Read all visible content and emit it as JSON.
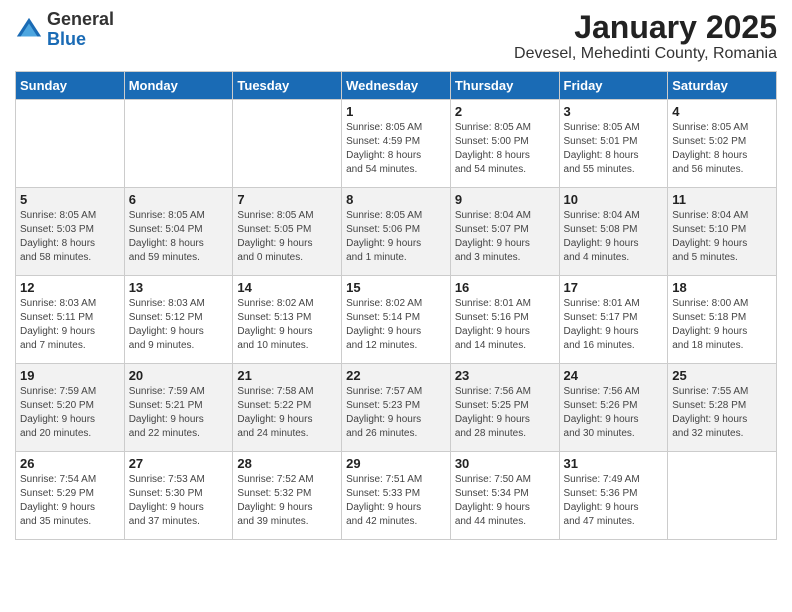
{
  "logo": {
    "general": "General",
    "blue": "Blue"
  },
  "header": {
    "title": "January 2025",
    "subtitle": "Devesel, Mehedinti County, Romania"
  },
  "weekdays": [
    "Sunday",
    "Monday",
    "Tuesday",
    "Wednesday",
    "Thursday",
    "Friday",
    "Saturday"
  ],
  "weeks": [
    [
      {
        "day": "",
        "info": ""
      },
      {
        "day": "",
        "info": ""
      },
      {
        "day": "",
        "info": ""
      },
      {
        "day": "1",
        "info": "Sunrise: 8:05 AM\nSunset: 4:59 PM\nDaylight: 8 hours\nand 54 minutes."
      },
      {
        "day": "2",
        "info": "Sunrise: 8:05 AM\nSunset: 5:00 PM\nDaylight: 8 hours\nand 54 minutes."
      },
      {
        "day": "3",
        "info": "Sunrise: 8:05 AM\nSunset: 5:01 PM\nDaylight: 8 hours\nand 55 minutes."
      },
      {
        "day": "4",
        "info": "Sunrise: 8:05 AM\nSunset: 5:02 PM\nDaylight: 8 hours\nand 56 minutes."
      }
    ],
    [
      {
        "day": "5",
        "info": "Sunrise: 8:05 AM\nSunset: 5:03 PM\nDaylight: 8 hours\nand 58 minutes."
      },
      {
        "day": "6",
        "info": "Sunrise: 8:05 AM\nSunset: 5:04 PM\nDaylight: 8 hours\nand 59 minutes."
      },
      {
        "day": "7",
        "info": "Sunrise: 8:05 AM\nSunset: 5:05 PM\nDaylight: 9 hours\nand 0 minutes."
      },
      {
        "day": "8",
        "info": "Sunrise: 8:05 AM\nSunset: 5:06 PM\nDaylight: 9 hours\nand 1 minute."
      },
      {
        "day": "9",
        "info": "Sunrise: 8:04 AM\nSunset: 5:07 PM\nDaylight: 9 hours\nand 3 minutes."
      },
      {
        "day": "10",
        "info": "Sunrise: 8:04 AM\nSunset: 5:08 PM\nDaylight: 9 hours\nand 4 minutes."
      },
      {
        "day": "11",
        "info": "Sunrise: 8:04 AM\nSunset: 5:10 PM\nDaylight: 9 hours\nand 5 minutes."
      }
    ],
    [
      {
        "day": "12",
        "info": "Sunrise: 8:03 AM\nSunset: 5:11 PM\nDaylight: 9 hours\nand 7 minutes."
      },
      {
        "day": "13",
        "info": "Sunrise: 8:03 AM\nSunset: 5:12 PM\nDaylight: 9 hours\nand 9 minutes."
      },
      {
        "day": "14",
        "info": "Sunrise: 8:02 AM\nSunset: 5:13 PM\nDaylight: 9 hours\nand 10 minutes."
      },
      {
        "day": "15",
        "info": "Sunrise: 8:02 AM\nSunset: 5:14 PM\nDaylight: 9 hours\nand 12 minutes."
      },
      {
        "day": "16",
        "info": "Sunrise: 8:01 AM\nSunset: 5:16 PM\nDaylight: 9 hours\nand 14 minutes."
      },
      {
        "day": "17",
        "info": "Sunrise: 8:01 AM\nSunset: 5:17 PM\nDaylight: 9 hours\nand 16 minutes."
      },
      {
        "day": "18",
        "info": "Sunrise: 8:00 AM\nSunset: 5:18 PM\nDaylight: 9 hours\nand 18 minutes."
      }
    ],
    [
      {
        "day": "19",
        "info": "Sunrise: 7:59 AM\nSunset: 5:20 PM\nDaylight: 9 hours\nand 20 minutes."
      },
      {
        "day": "20",
        "info": "Sunrise: 7:59 AM\nSunset: 5:21 PM\nDaylight: 9 hours\nand 22 minutes."
      },
      {
        "day": "21",
        "info": "Sunrise: 7:58 AM\nSunset: 5:22 PM\nDaylight: 9 hours\nand 24 minutes."
      },
      {
        "day": "22",
        "info": "Sunrise: 7:57 AM\nSunset: 5:23 PM\nDaylight: 9 hours\nand 26 minutes."
      },
      {
        "day": "23",
        "info": "Sunrise: 7:56 AM\nSunset: 5:25 PM\nDaylight: 9 hours\nand 28 minutes."
      },
      {
        "day": "24",
        "info": "Sunrise: 7:56 AM\nSunset: 5:26 PM\nDaylight: 9 hours\nand 30 minutes."
      },
      {
        "day": "25",
        "info": "Sunrise: 7:55 AM\nSunset: 5:28 PM\nDaylight: 9 hours\nand 32 minutes."
      }
    ],
    [
      {
        "day": "26",
        "info": "Sunrise: 7:54 AM\nSunset: 5:29 PM\nDaylight: 9 hours\nand 35 minutes."
      },
      {
        "day": "27",
        "info": "Sunrise: 7:53 AM\nSunset: 5:30 PM\nDaylight: 9 hours\nand 37 minutes."
      },
      {
        "day": "28",
        "info": "Sunrise: 7:52 AM\nSunset: 5:32 PM\nDaylight: 9 hours\nand 39 minutes."
      },
      {
        "day": "29",
        "info": "Sunrise: 7:51 AM\nSunset: 5:33 PM\nDaylight: 9 hours\nand 42 minutes."
      },
      {
        "day": "30",
        "info": "Sunrise: 7:50 AM\nSunset: 5:34 PM\nDaylight: 9 hours\nand 44 minutes."
      },
      {
        "day": "31",
        "info": "Sunrise: 7:49 AM\nSunset: 5:36 PM\nDaylight: 9 hours\nand 47 minutes."
      },
      {
        "day": "",
        "info": ""
      }
    ]
  ]
}
